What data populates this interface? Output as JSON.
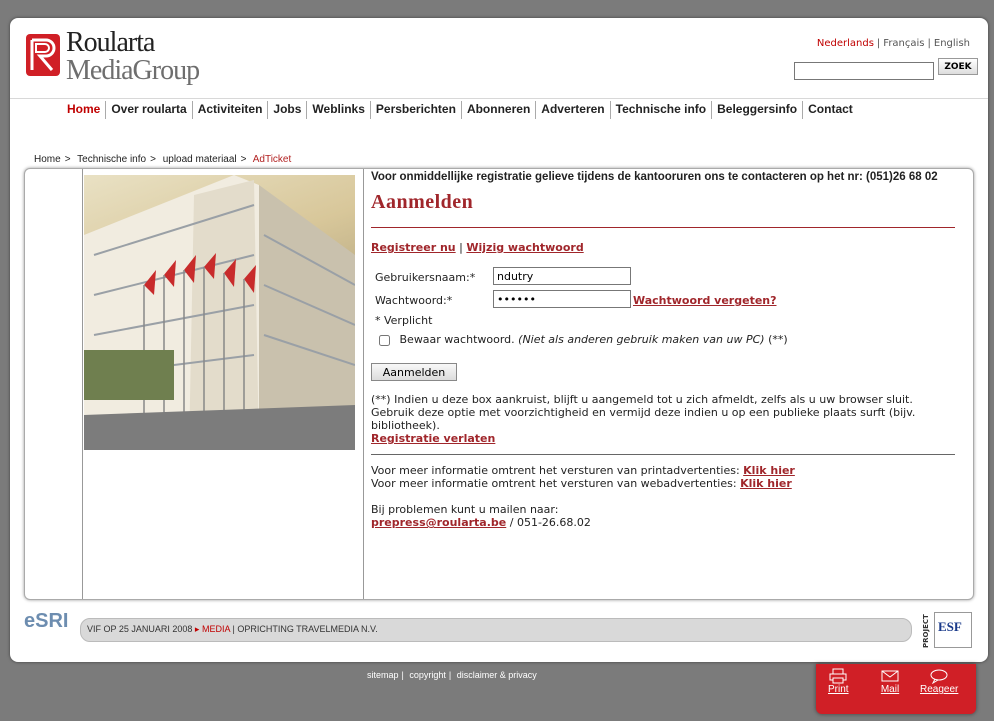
{
  "brand": {
    "line1": "Roularta",
    "line2": "MediaGroup"
  },
  "languages": [
    {
      "label": "Nederlands",
      "active": true
    },
    {
      "label": "Français",
      "active": false
    },
    {
      "label": "English",
      "active": false
    }
  ],
  "search": {
    "value": "",
    "button": "ZOEK"
  },
  "nav": [
    "Home",
    "Over roularta",
    "Activiteiten",
    "Jobs",
    "Weblinks",
    "Persberichten",
    "Abonneren",
    "Adverteren",
    "Technische info",
    "Beleggersinfo",
    "Contact"
  ],
  "breadcrumb": {
    "items": [
      "Home",
      "Technische info",
      "upload materiaal"
    ],
    "sep": ">",
    "current": "AdTicket"
  },
  "main": {
    "intro": "Voor onmiddellijke registratie gelieve tijdens de kantooruren ons te contacteren op het nr: (051)26 68 02",
    "title": "Aanmelden",
    "register_link": "Registreer nu",
    "link_sep": "|",
    "change_pw_link": "Wijzig wachtwoord",
    "username_label": "Gebruikersnaam:*",
    "username_value": "ndutry",
    "password_label": "Wachtwoord:*",
    "password_value": "••••••",
    "forgot_link": "Wachtwoord vergeten?",
    "required_note": "* Verplicht",
    "remember_label": "Bewaar wachtwoord.",
    "remember_note": "(Niet als anderen gebruik maken van uw PC)",
    "remember_suffix": "(**)",
    "submit": "Aanmelden",
    "footnote1": "(**) Indien u deze box aankruist, blijft u aangemeld tot u zich afmeldt, zelfs als u uw browser sluit.",
    "footnote2": "Gebruik deze optie met voorzichtigheid en vermijd deze indien u op een publieke plaats surft (bijv.",
    "footnote3": "bibliotheek).",
    "leave_link": "Registratie verlaten",
    "print_info": "Voor meer informatie omtrent het versturen van printadvertenties:",
    "print_link": "Klik hier",
    "web_info": "Voor meer informatie omtrent het versturen van webadvertenties:",
    "web_link": "Klik hier",
    "problems": "Bij problemen kunt u mailen naar:",
    "email": "prepress@roularta.be",
    "phone": "/ 051-26.68.02"
  },
  "footer": {
    "ticker_a": "VIF OP 25 JANUARI 2008",
    "ticker_arrow": "▸",
    "ticker_red": "MEDIA",
    "ticker_b": "| OPRICHTING TRAVELMEDIA N.V.",
    "esri": "eSRI",
    "project": "PROJECT",
    "esf": "ESF"
  },
  "bottom_links": [
    "sitemap",
    "copyright",
    "disclaimer & privacy"
  ],
  "share": [
    {
      "label": "Print",
      "icon": "printer-icon"
    },
    {
      "label": "Mail",
      "icon": "mail-icon"
    },
    {
      "label": "Reageer",
      "icon": "speech-bubble-icon"
    }
  ]
}
